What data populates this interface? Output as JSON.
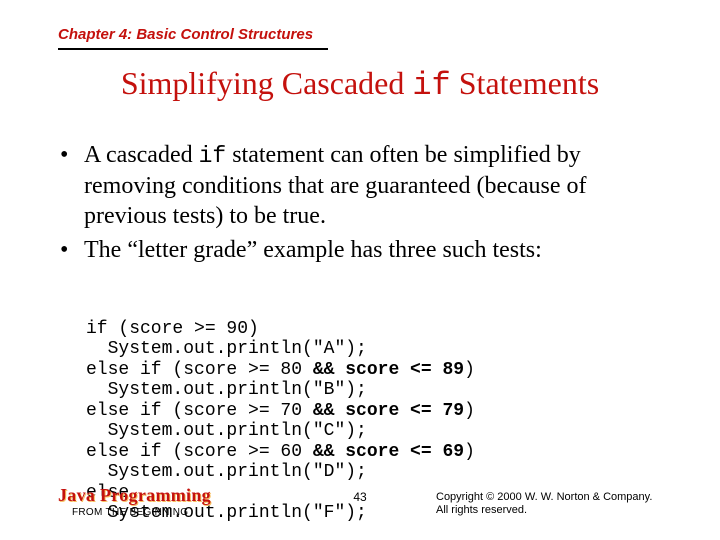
{
  "chapter": "Chapter 4: Basic Control Structures",
  "title": {
    "pre": "Simplifying Cascaded ",
    "mono": "if",
    "post": " Statements"
  },
  "bullets": {
    "b1": {
      "pre": "A cascaded ",
      "mono": "if",
      "post": " statement can often be simplified by removing conditions that are guaranteed (because of previous tests) to be true."
    },
    "b2": "The “letter grade” example has three such tests:"
  },
  "code": {
    "l1a": "if (score >= 90)",
    "l1b": "  System.out.println(\"A\");",
    "l2a_pre": "else if (score >= 80 ",
    "l2a_bold": "&& score <= 89",
    "l2a_post": ")",
    "l2b": "  System.out.println(\"B\");",
    "l3a_pre": "else if (score >= 70 ",
    "l3a_bold": "&& score <= 79",
    "l3a_post": ")",
    "l3b": "  System.out.println(\"C\");",
    "l4a_pre": "else if (score >= 60 ",
    "l4a_bold": "&& score <= 69",
    "l4a_post": ")",
    "l4b": "  System.out.println(\"D\");",
    "l5a": "else",
    "l5b": "  System.out.println(\"F\");"
  },
  "footer": {
    "book": "Java Programming",
    "sub": "FROM THE BEGINNING",
    "page": "43",
    "copy1": "Copyright © 2000 W. W. Norton & Company.",
    "copy2": "All rights reserved."
  }
}
